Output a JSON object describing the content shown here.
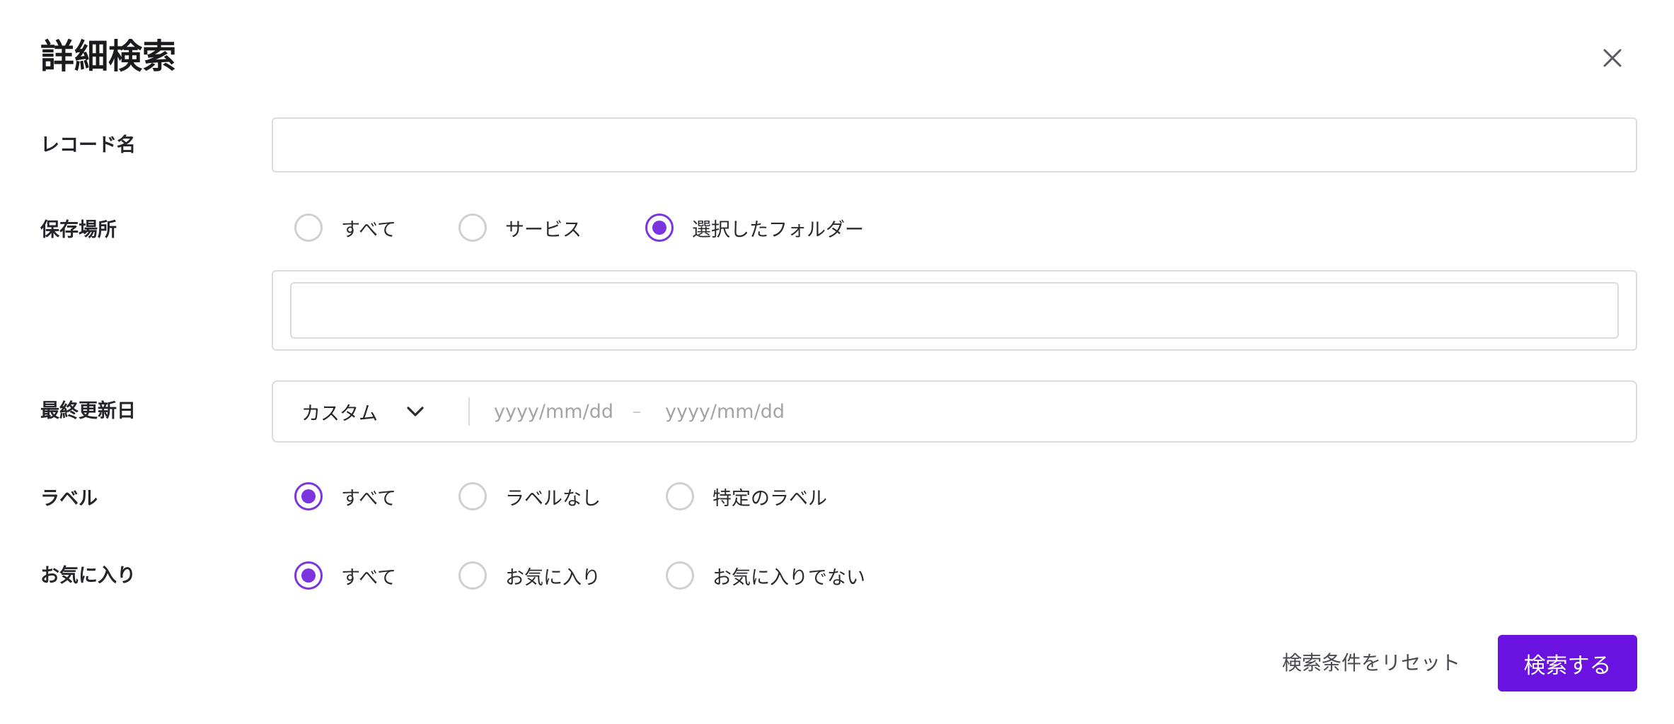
{
  "dialog": {
    "title": "詳細検索"
  },
  "fields": {
    "record_name": {
      "label": "レコード名",
      "value": ""
    },
    "location": {
      "label": "保存場所",
      "options": [
        "すべて",
        "サービス",
        "選択したフォルダー"
      ],
      "selected": "選択したフォルダー",
      "folder_value": ""
    },
    "last_updated": {
      "label": "最終更新日",
      "range_type": "カスタム",
      "from_placeholder": "yyyy/mm/dd",
      "separator": "–",
      "to_placeholder": "yyyy/mm/dd"
    },
    "label_filter": {
      "label": "ラベル",
      "options": [
        "すべて",
        "ラベルなし",
        "特定のラベル"
      ],
      "selected": "すべて"
    },
    "favorite": {
      "label": "お気に入り",
      "options": [
        "すべて",
        "お気に入り",
        "お気に入りでない"
      ],
      "selected": "すべて"
    }
  },
  "actions": {
    "reset_label": "検索条件をリセット",
    "submit_label": "検索する"
  },
  "colors": {
    "accent": "#7a34e0",
    "primary_button": "#6a12e0",
    "border": "#dcdce0"
  },
  "icons": {
    "close": "close-icon",
    "dropdown": "chevron-down-icon"
  }
}
